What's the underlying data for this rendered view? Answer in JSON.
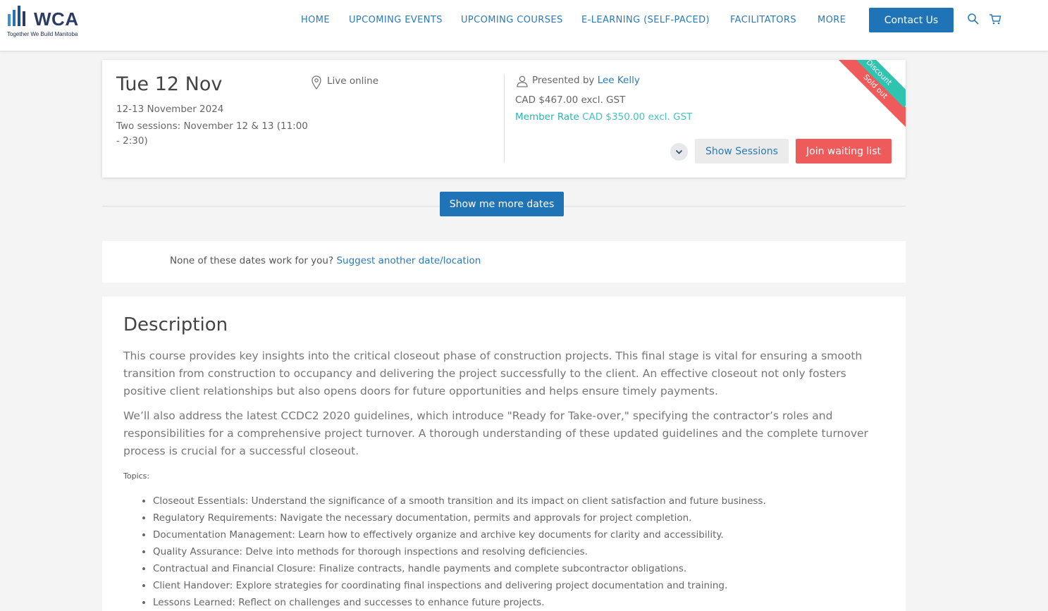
{
  "header": {
    "logo_text": "WCA",
    "logo_tagline": "Together We Build Manitoba",
    "nav": [
      {
        "label": "HOME"
      },
      {
        "label": "UPCOMING EVENTS"
      },
      {
        "label": "UPCOMING COURSES"
      },
      {
        "label": "E-LEARNING (SELF-PACED)"
      },
      {
        "label": "FACILITATORS"
      },
      {
        "label": "MORE"
      }
    ],
    "contact_label": "Contact Us",
    "icons": [
      "search-icon",
      "cart-icon"
    ]
  },
  "session": {
    "date_big": "Tue 12 Nov",
    "date_range": "12-13 November 2024",
    "sessions_note": "Two sessions: November 12 & 13 (11:00 - 2:30)",
    "location": "Live online",
    "presented_by_label": "Presented by",
    "presenter": "Lee Kelly",
    "price": "CAD $467.00 excl. GST",
    "member_label": "Member Rate",
    "member_price": "CAD $350.00 excl. GST",
    "show_sessions_label": "Show Sessions",
    "join_label": "Join waiting list",
    "ribbon_discount": "Discount",
    "ribbon_soldout": "Sold out"
  },
  "more_dates_label": "Show me more dates",
  "suggest": {
    "text": "None of these dates work for you?",
    "link": "Suggest another date/location"
  },
  "description": {
    "title": "Description",
    "p1": "This course provides key insights into the critical closeout phase of construction projects. This final stage is vital for ensuring a smooth transition from construction to occupancy and delivering the project successfully to the client. An effective closeout not only fosters positive client relationships but also opens doors for future opportunities and helps ensure timely payments.",
    "p2": "We’ll also address the latest CCDC2 2020 guidelines, which introduce \"Ready for Take-over,\" specifying the contractor’s roles and responsibilities for a comprehensive project turnover. A thorough understanding of these updated guidelines and the complete turnover process is crucial for a successful closeout.",
    "topics_label": "Topics:",
    "topics": [
      "Closeout Essentials: Understand the significance of a smooth transition and its impact on client satisfaction and future business.",
      "Regulatory Requirements: Navigate the necessary documentation, permits and approvals for project completion.",
      "Documentation Management: Learn how to effectively organize and archive key documents for clarity and accessibility.",
      "Quality Assurance: Delve into methods for thorough inspections and resolving deficiencies.",
      "Contractual and Financial Closure: Finalize contracts, handle payments and complete subcontractor obligations.",
      "Client Handover: Explore strategies for coordinating final inspections and delivering project documentation and training.",
      "Lessons Learned: Reflect on challenges and successes to enhance future projects."
    ]
  },
  "colors": {
    "brand_blue": "#1f73b7",
    "link_blue": "#2a7ab8",
    "teal": "#2ec4b0",
    "red": "#ef5b5b"
  }
}
